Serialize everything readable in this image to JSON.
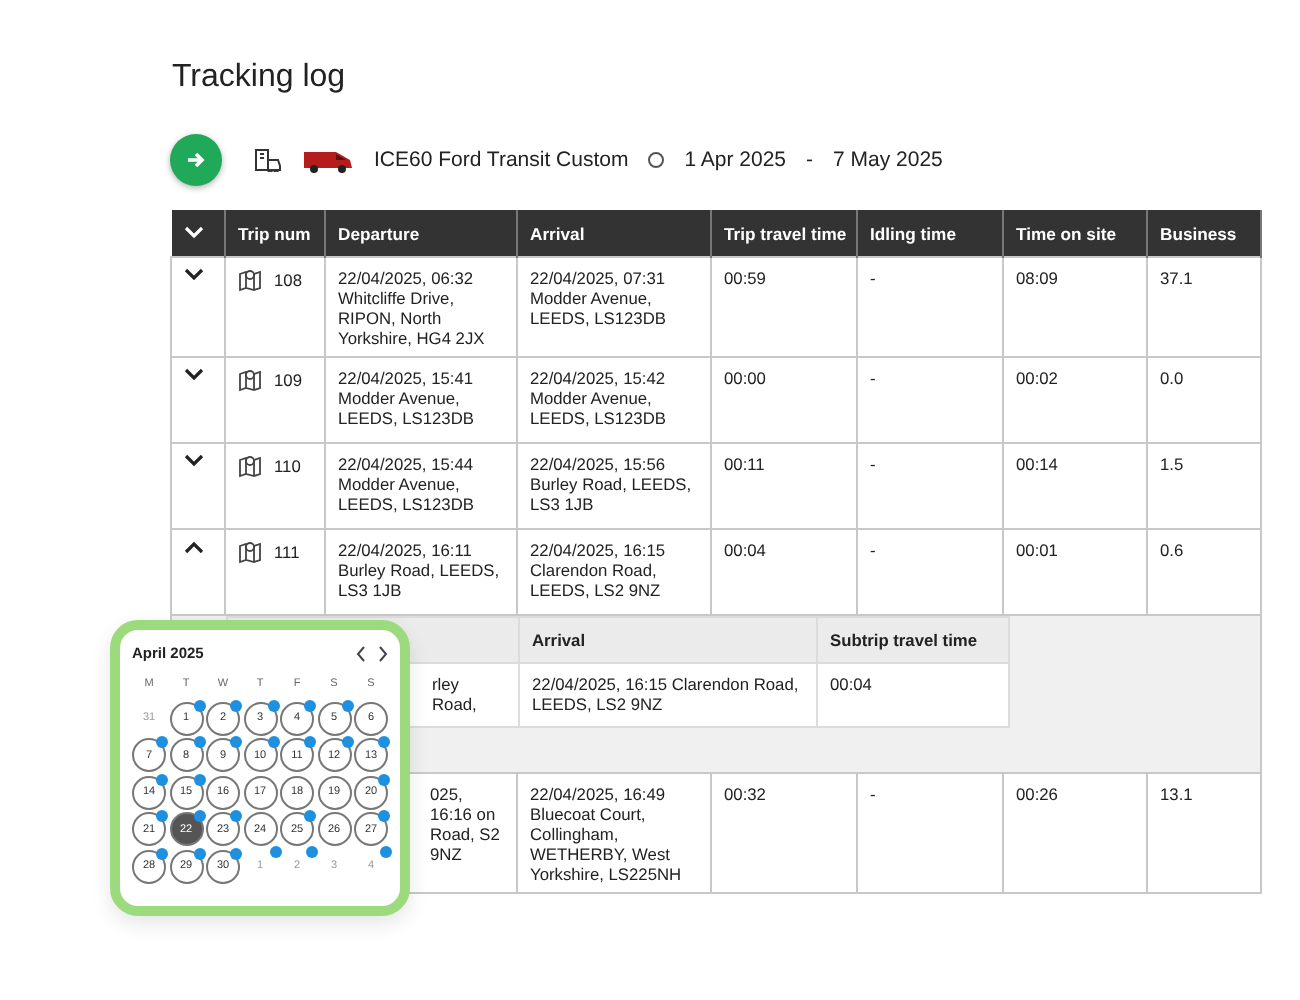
{
  "title": "Tracking log",
  "vehicle": {
    "name": "ICE60 Ford Transit Custom",
    "date_from": "1 Apr 2025",
    "separator": "-",
    "date_to": "7 May 2025"
  },
  "table": {
    "columns": [
      "Trip num",
      "Departure",
      "Arrival",
      "Trip travel time",
      "Idling time",
      "Time on site",
      "Business"
    ],
    "rows": [
      {
        "expanded": false,
        "trip_num": "108",
        "departure": "22/04/2025, 06:32 Whitcliffe Drive, RIPON, North Yorkshire, HG4 2JX",
        "arrival": "22/04/2025, 07:31 Modder Avenue, LEEDS, LS123DB",
        "travel": "00:59",
        "idling": "-",
        "on_site": "08:09",
        "business": "37.1"
      },
      {
        "expanded": false,
        "trip_num": "109",
        "departure": "22/04/2025, 15:41 Modder Avenue, LEEDS, LS123DB",
        "arrival": "22/04/2025, 15:42 Modder Avenue, LEEDS, LS123DB",
        "travel": "00:00",
        "idling": "-",
        "on_site": "00:02",
        "business": "0.0"
      },
      {
        "expanded": false,
        "trip_num": "110",
        "departure": "22/04/2025, 15:44 Modder Avenue, LEEDS, LS123DB",
        "arrival": "22/04/2025, 15:56 Burley Road, LEEDS, LS3 1JB",
        "travel": "00:11",
        "idling": "-",
        "on_site": "00:14",
        "business": "1.5"
      },
      {
        "expanded": true,
        "trip_num": "111",
        "departure": "22/04/2025, 16:11 Burley Road, LEEDS, LS3 1JB",
        "arrival": "22/04/2025, 16:15 Clarendon Road, LEEDS, LS2 9NZ",
        "travel": "00:04",
        "idling": "-",
        "on_site": "00:01",
        "business": "0.6",
        "subtrips": {
          "columns": [
            "Arrival",
            "Subtrip travel time"
          ],
          "rows": [
            {
              "departure": "rley Road,",
              "arrival": "22/04/2025, 16:15 Clarendon Road, LEEDS, LS2 9NZ",
              "travel": "00:04"
            }
          ]
        }
      },
      {
        "departure": "025, 16:16 on Road, S2 9NZ",
        "arrival": "22/04/2025, 16:49 Bluecoat Court, Collingham, WETHERBY, West Yorkshire, LS225NH",
        "travel": "00:32",
        "idling": "-",
        "on_site": "00:26",
        "business": "13.1"
      }
    ]
  },
  "calendar": {
    "month": "April 2025",
    "weekdays": [
      "M",
      "T",
      "W",
      "T",
      "F",
      "S",
      "S"
    ],
    "days": [
      {
        "label": "31",
        "outside": true,
        "marked": false,
        "selected": false
      },
      {
        "label": "1",
        "outside": false,
        "marked": true,
        "selected": false
      },
      {
        "label": "2",
        "outside": false,
        "marked": true,
        "selected": false
      },
      {
        "label": "3",
        "outside": false,
        "marked": true,
        "selected": false
      },
      {
        "label": "4",
        "outside": false,
        "marked": true,
        "selected": false
      },
      {
        "label": "5",
        "outside": false,
        "marked": true,
        "selected": false
      },
      {
        "label": "6",
        "outside": false,
        "marked": false,
        "selected": false
      },
      {
        "label": "7",
        "outside": false,
        "marked": true,
        "selected": false
      },
      {
        "label": "8",
        "outside": false,
        "marked": true,
        "selected": false
      },
      {
        "label": "9",
        "outside": false,
        "marked": true,
        "selected": false
      },
      {
        "label": "10",
        "outside": false,
        "marked": true,
        "selected": false
      },
      {
        "label": "11",
        "outside": false,
        "marked": true,
        "selected": false
      },
      {
        "label": "12",
        "outside": false,
        "marked": true,
        "selected": false
      },
      {
        "label": "13",
        "outside": false,
        "marked": true,
        "selected": false
      },
      {
        "label": "14",
        "outside": false,
        "marked": true,
        "selected": false
      },
      {
        "label": "15",
        "outside": false,
        "marked": true,
        "selected": false
      },
      {
        "label": "16",
        "outside": false,
        "marked": false,
        "selected": false
      },
      {
        "label": "17",
        "outside": false,
        "marked": false,
        "selected": false
      },
      {
        "label": "18",
        "outside": false,
        "marked": false,
        "selected": false
      },
      {
        "label": "19",
        "outside": false,
        "marked": false,
        "selected": false
      },
      {
        "label": "20",
        "outside": false,
        "marked": true,
        "selected": false
      },
      {
        "label": "21",
        "outside": false,
        "marked": true,
        "selected": false
      },
      {
        "label": "22",
        "outside": false,
        "marked": true,
        "selected": true
      },
      {
        "label": "23",
        "outside": false,
        "marked": true,
        "selected": false
      },
      {
        "label": "24",
        "outside": false,
        "marked": false,
        "selected": false
      },
      {
        "label": "25",
        "outside": false,
        "marked": true,
        "selected": false
      },
      {
        "label": "26",
        "outside": false,
        "marked": false,
        "selected": false
      },
      {
        "label": "27",
        "outside": false,
        "marked": true,
        "selected": false
      },
      {
        "label": "28",
        "outside": false,
        "marked": true,
        "selected": false
      },
      {
        "label": "29",
        "outside": false,
        "marked": true,
        "selected": false
      },
      {
        "label": "30",
        "outside": false,
        "marked": true,
        "selected": false
      },
      {
        "label": "1",
        "outside": true,
        "marked": true,
        "selected": false
      },
      {
        "label": "2",
        "outside": true,
        "marked": true,
        "selected": false
      },
      {
        "label": "3",
        "outside": true,
        "marked": false,
        "selected": false
      },
      {
        "label": "4",
        "outside": true,
        "marked": true,
        "selected": false
      }
    ]
  }
}
